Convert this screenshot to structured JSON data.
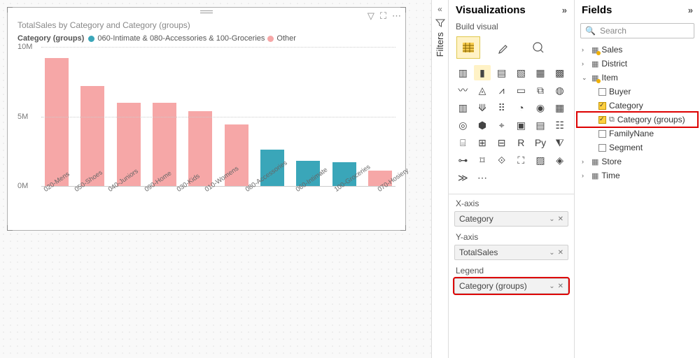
{
  "chart_data": {
    "type": "bar",
    "title": "TotalSales by Category and Category (groups)",
    "ylabel": "",
    "xlabel": "",
    "ylim": [
      0,
      10000000
    ],
    "yticks": [
      {
        "v": 0,
        "label": "0M"
      },
      {
        "v": 5000000,
        "label": "5M"
      },
      {
        "v": 10000000,
        "label": "10M"
      }
    ],
    "legend_title": "Category (groups)",
    "series_names": [
      "060-Intimate & 080-Accessories & 100-Groceries",
      "Other"
    ],
    "colors": {
      "Other": "#f6a7a7",
      "060-Intimate & 080-Accessories & 100-Groceries": "#3aa6b9"
    },
    "bars": [
      {
        "category": "020-Mens",
        "value": 9200000,
        "group": "Other"
      },
      {
        "category": "050-Shoes",
        "value": 7200000,
        "group": "Other"
      },
      {
        "category": "040-Juniors",
        "value": 6000000,
        "group": "Other"
      },
      {
        "category": "090-Home",
        "value": 6000000,
        "group": "Other"
      },
      {
        "category": "030-Kids",
        "value": 5400000,
        "group": "Other"
      },
      {
        "category": "010-Womens",
        "value": 4400000,
        "group": "Other"
      },
      {
        "category": "080-Accessories",
        "value": 2600000,
        "group": "060-Intimate & 080-Accessories & 100-Groceries"
      },
      {
        "category": "060-Intimate",
        "value": 1800000,
        "group": "060-Intimate & 080-Accessories & 100-Groceries"
      },
      {
        "category": "100-Groceries",
        "value": 1700000,
        "group": "060-Intimate & 080-Accessories & 100-Groceries"
      },
      {
        "category": "070-Hosiery",
        "value": 1100000,
        "group": "Other"
      }
    ]
  },
  "filters_label": "Filters",
  "viz": {
    "title": "Visualizations",
    "build_label": "Build visual",
    "types": [
      "▥",
      "▮",
      "▤",
      "▧",
      "▦",
      "▩",
      "〰",
      "◬",
      "⩘",
      "▭",
      "⧉",
      "◍",
      "▥",
      "⟱",
      "⠿",
      "◔",
      "◉",
      "▦",
      "◎",
      "⬢",
      "⌖",
      "▣",
      "▤",
      "☷",
      "⌸",
      "⊞",
      "⊟",
      "R",
      "Py",
      "⧨",
      "⊶",
      "⌑",
      "⟐",
      "⛶",
      "▨",
      "◈",
      "≫",
      "⋯"
    ],
    "sel_idx": 1,
    "wells": {
      "x": {
        "label": "X-axis",
        "field": "Category"
      },
      "y": {
        "label": "Y-axis",
        "field": "TotalSales"
      },
      "legend": {
        "label": "Legend",
        "field": "Category (groups)"
      }
    }
  },
  "fields": {
    "title": "Fields",
    "search_placeholder": "Search",
    "tables": [
      {
        "name": "Sales",
        "open": false,
        "badge": true
      },
      {
        "name": "District",
        "open": false
      },
      {
        "name": "Item",
        "open": true,
        "badge": true,
        "fields": [
          {
            "name": "Buyer",
            "checked": false
          },
          {
            "name": "Category",
            "checked": true
          },
          {
            "name": "Category (groups)",
            "checked": true,
            "highlight": true,
            "group_icon": true
          },
          {
            "name": "FamilyNane",
            "checked": false
          },
          {
            "name": "Segment",
            "checked": false
          }
        ]
      },
      {
        "name": "Store",
        "open": false
      },
      {
        "name": "Time",
        "open": false
      }
    ]
  }
}
